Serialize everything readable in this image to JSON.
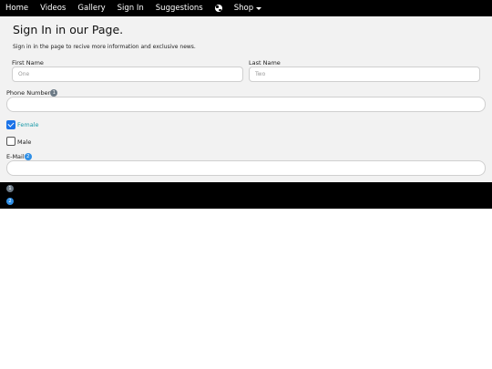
{
  "nav": {
    "items": [
      "Home",
      "Videos",
      "Gallery",
      "Sign In",
      "Suggestions"
    ],
    "globe_icon": "globe-icon",
    "shop_label": "Shop"
  },
  "form": {
    "title": "Sign In in our Page.",
    "subtitle": "Sign in in the page to recive more information and exclusive news.",
    "first_name": {
      "label": "First Name",
      "placeholder": "One"
    },
    "last_name": {
      "label": "Last Name",
      "placeholder": "Two"
    },
    "phone": {
      "label": "Phone Number",
      "badge": "1",
      "value": ""
    },
    "gender": {
      "female": {
        "label": "Female",
        "checked": true
      },
      "male": {
        "label": "Male",
        "checked": false
      }
    },
    "email": {
      "label": "E-Mail",
      "badge": "2",
      "value": ""
    }
  },
  "colors": {
    "accent": "#1a73e8",
    "female_label": "#1a9aa8",
    "nav_bg": "#000000",
    "panel_bg": "#f2f2f2"
  },
  "footer": {
    "notes": [
      "1",
      "2"
    ]
  }
}
